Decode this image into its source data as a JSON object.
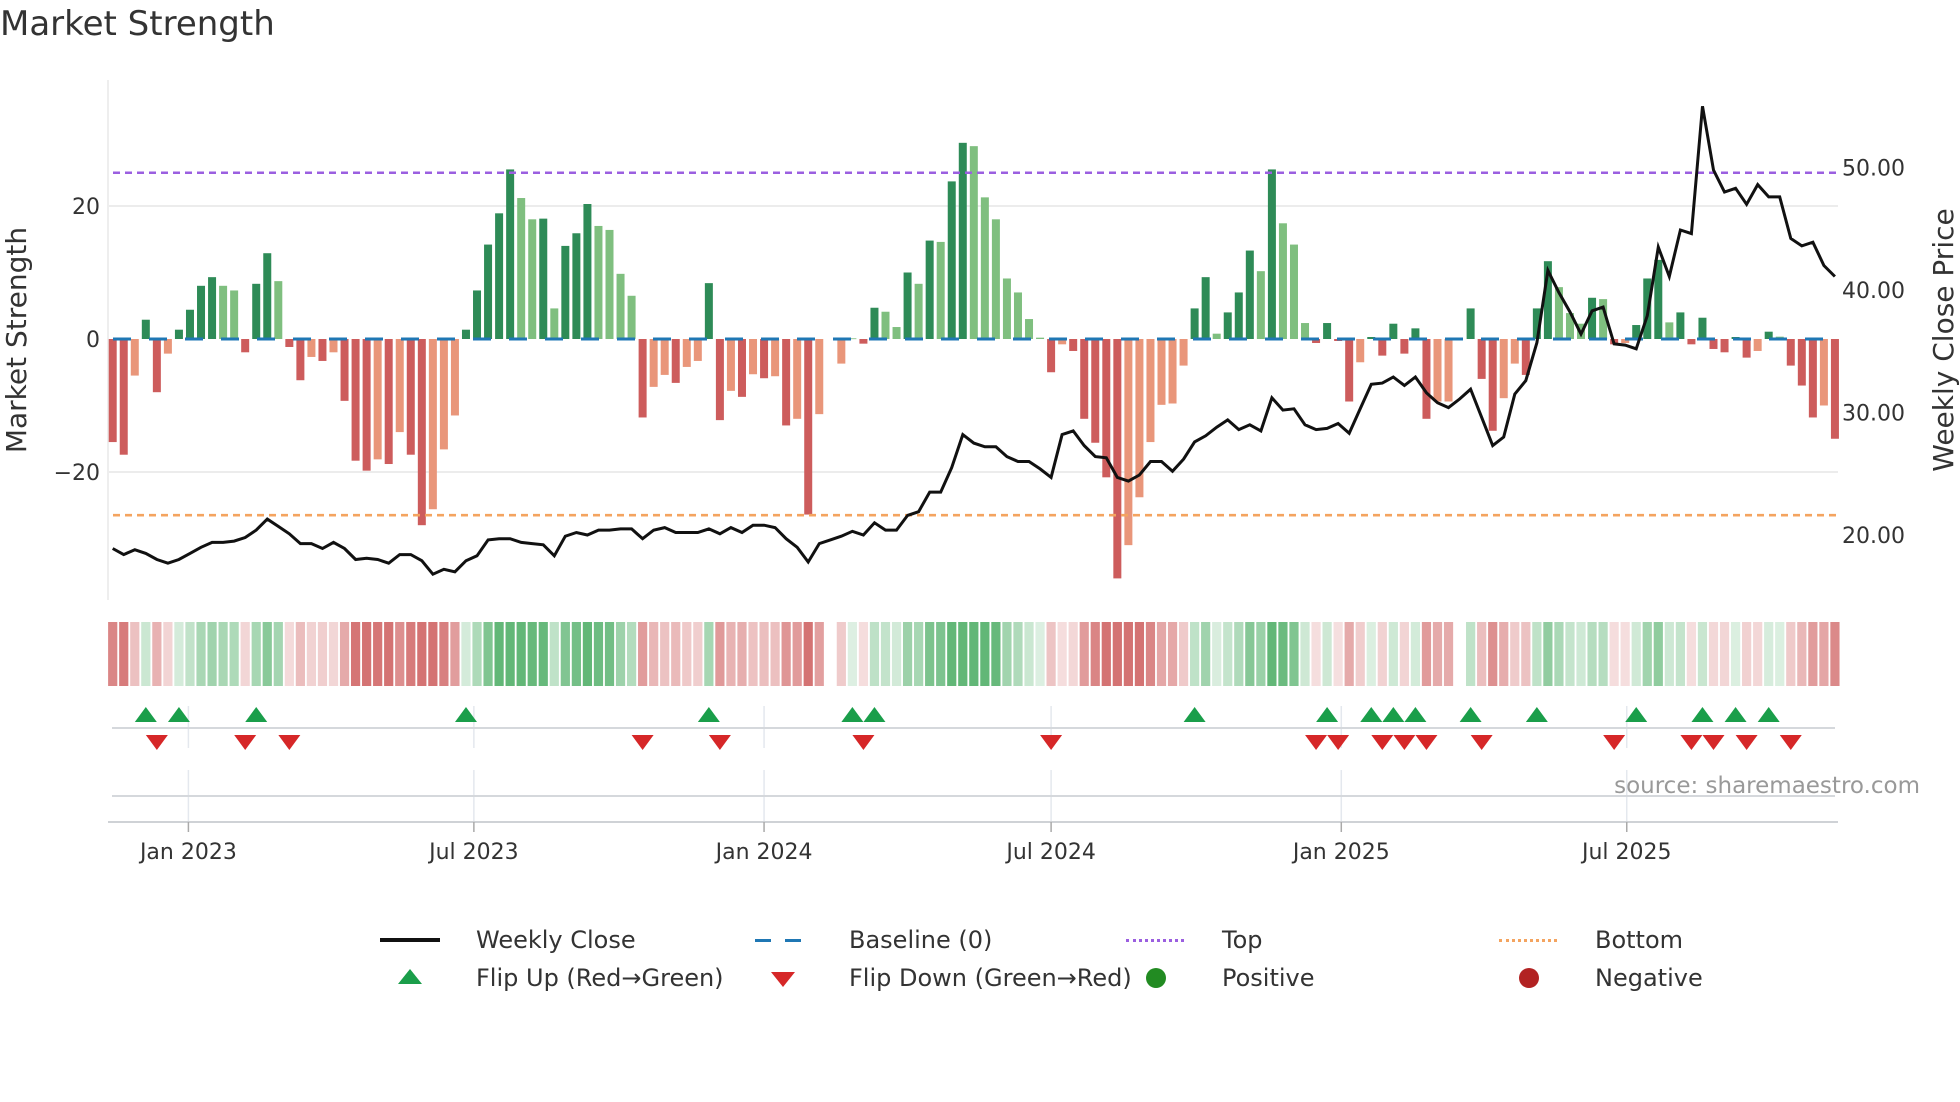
{
  "title": "Market Strength",
  "source": "source: sharemaestro.com",
  "legend": {
    "weekly_close": "Weekly Close",
    "baseline": "Baseline (0)",
    "top": "Top",
    "bottom": "Bottom",
    "flip_up": "Flip Up (Red→Green)",
    "flip_down": "Flip Down (Green→Red)",
    "positive": "Positive",
    "negative": "Negative"
  },
  "colors": {
    "dark_green": "#2e8b57",
    "light_green": "#7fbf7f",
    "dark_red": "#cd5c5c",
    "light_red": "#e9967a",
    "baseline": "#1f77b4",
    "top": "#9b5fe0",
    "bottom": "#f4a460",
    "close": "#111111",
    "flip_up": "#1a9e4a",
    "flip_down": "#d62728",
    "positive": "#228b22",
    "negative": "#b22222"
  },
  "chart_data": {
    "type": "bar",
    "title": "Market Strength",
    "ylabel": "Market Strength",
    "y2label": "Weekly Close Price",
    "start_date": "2022-11-14",
    "interval_days": 7,
    "ylim": [
      -38,
      35
    ],
    "y2lim": [
      14,
      58
    ],
    "y_ticks": [
      {
        "value": 20,
        "label": "20"
      },
      {
        "value": 0,
        "label": "0"
      },
      {
        "value": -20,
        "label": "−20"
      }
    ],
    "y2_ticks": [
      {
        "value": 50,
        "label": "50.00"
      },
      {
        "value": 40,
        "label": "40.00"
      },
      {
        "value": 30,
        "label": "30.00"
      },
      {
        "value": 20,
        "label": "20.00"
      }
    ],
    "x_ticks": [
      {
        "date": "2023-01-01",
        "label": "Jan 2023"
      },
      {
        "date": "2023-07-01",
        "label": "Jul 2023"
      },
      {
        "date": "2024-01-01",
        "label": "Jan 2024"
      },
      {
        "date": "2024-07-01",
        "label": "Jul 2024"
      },
      {
        "date": "2025-01-01",
        "label": "Jan 2025"
      },
      {
        "date": "2025-07-01",
        "label": "Jul 2025"
      }
    ],
    "top_level": 25,
    "bottom_level": -26.5,
    "baseline": 0,
    "strength": [
      -15.5,
      -17.4,
      -5.5,
      2.9,
      -8,
      -2.2,
      1.4,
      4.4,
      8,
      9.3,
      8,
      7.3,
      -2,
      8.3,
      12.9,
      8.7,
      -1.2,
      -6.2,
      -2.7,
      -3.3,
      -2,
      -9.3,
      -18.3,
      -19.8,
      -18.1,
      -18.8,
      -14,
      -17.4,
      -28,
      -25.6,
      -16.6,
      -11.5,
      1.4,
      7.3,
      14.2,
      18.9,
      25.5,
      21.2,
      18,
      18.1,
      4.6,
      14,
      15.9,
      20.3,
      17,
      16.4,
      9.8,
      6.5,
      -11.8,
      -7.2,
      -5.4,
      -6.6,
      -4.2,
      -3.3,
      8.4,
      -12.2,
      -7.8,
      -8.7,
      -5.3,
      -5.9,
      -5.6,
      -13,
      -12,
      -26.4,
      -11.3,
      0,
      -3.7,
      0.1,
      -0.7,
      4.7,
      4.1,
      1.8,
      10,
      8.3,
      14.8,
      14.6,
      23.7,
      29.5,
      29,
      21.3,
      18,
      9.1,
      7,
      3,
      0.2,
      -5,
      -0.8,
      -1.8,
      -12,
      -15.6,
      -20.8,
      -36,
      -31,
      -23.8,
      -15.5,
      -9.9,
      -9.7,
      -4,
      4.6,
      9.3,
      0.8,
      4,
      7,
      13.3,
      10.2,
      25.5,
      17.4,
      14.2,
      2.4,
      -0.6,
      2.4,
      -0.3,
      -9.4,
      -3.5,
      0.3,
      -2.5,
      2.3,
      -2.2,
      1.6,
      -12,
      -9.4,
      -9.4,
      0,
      4.6,
      -6,
      -13.8,
      -8.9,
      -3.7,
      -5.4,
      4.6,
      11.7,
      7.8,
      3.9,
      2.3,
      6.2,
      6,
      -0.8,
      -0.6,
      2.1,
      9.1,
      11.9,
      2.5,
      4,
      -0.8,
      3.2,
      -1.5,
      -2,
      0.3,
      -2.8,
      -1.8,
      1.1,
      0.35,
      -4,
      -7,
      -11.8,
      -10,
      -15
    ],
    "shade": [
      "dr",
      "dr",
      "lr",
      "dg",
      "dr",
      "lr",
      "dg",
      "dg",
      "dg",
      "dg",
      "lg",
      "lg",
      "dr",
      "dg",
      "dg",
      "lg",
      "dr",
      "dr",
      "lr",
      "dr",
      "lr",
      "dr",
      "dr",
      "dr",
      "lr",
      "dr",
      "lr",
      "dr",
      "dr",
      "lr",
      "lr",
      "lr",
      "dg",
      "dg",
      "dg",
      "dg",
      "dg",
      "lg",
      "lg",
      "dg",
      "lg",
      "dg",
      "dg",
      "dg",
      "lg",
      "lg",
      "lg",
      "lg",
      "dr",
      "lr",
      "lr",
      "dr",
      "lr",
      "lr",
      "dg",
      "dr",
      "lr",
      "dr",
      "lr",
      "dr",
      "lr",
      "dr",
      "lr",
      "dr",
      "lr",
      "lr",
      "lr",
      "lg",
      "dr",
      "dg",
      "lg",
      "lg",
      "dg",
      "lg",
      "dg",
      "lg",
      "dg",
      "dg",
      "lg",
      "lg",
      "lg",
      "lg",
      "lg",
      "lg",
      "lg",
      "dr",
      "lr",
      "dr",
      "dr",
      "dr",
      "dr",
      "dr",
      "lr",
      "lr",
      "lr",
      "lr",
      "lr",
      "lr",
      "dg",
      "dg",
      "lg",
      "dg",
      "dg",
      "dg",
      "lg",
      "dg",
      "lg",
      "lg",
      "lg",
      "dr",
      "dg",
      "dr",
      "dr",
      "lr",
      "dg",
      "dr",
      "dg",
      "dr",
      "dg",
      "dr",
      "lr",
      "lr",
      "lr",
      "dg",
      "dr",
      "dr",
      "lr",
      "lr",
      "dr",
      "dg",
      "dg",
      "lg",
      "lg",
      "lg",
      "dg",
      "lg",
      "dr",
      "lr",
      "dg",
      "dg",
      "dg",
      "lg",
      "dg",
      "dr",
      "dg",
      "dr",
      "dr",
      "dg",
      "dr",
      "lr",
      "dg",
      "lg",
      "dr",
      "dr",
      "dr",
      "lr",
      "dr"
    ],
    "weekly_close": [
      18.9,
      18.4,
      18.8,
      18.5,
      18.0,
      17.7,
      18.0,
      18.5,
      19.0,
      19.4,
      19.4,
      19.5,
      19.8,
      20.4,
      21.3,
      20.7,
      20.1,
      19.3,
      19.3,
      18.9,
      19.4,
      18.9,
      18.0,
      18.1,
      18.0,
      17.7,
      18.4,
      18.4,
      17.9,
      16.8,
      17.2,
      17.0,
      17.9,
      18.3,
      19.6,
      19.7,
      19.7,
      19.4,
      19.3,
      19.2,
      18.3,
      19.9,
      20.2,
      20.0,
      20.4,
      20.4,
      20.5,
      20.5,
      19.7,
      20.4,
      20.6,
      20.2,
      20.2,
      20.2,
      20.5,
      20.1,
      20.6,
      20.2,
      20.8,
      20.8,
      20.6,
      19.7,
      19.0,
      17.8,
      19.3,
      19.6,
      19.9,
      20.3,
      20.0,
      21.0,
      20.4,
      20.4,
      21.6,
      21.9,
      23.5,
      23.5,
      25.5,
      28.2,
      27.5,
      27.2,
      27.2,
      26.4,
      26.0,
      26.0,
      25.4,
      24.7,
      28.2,
      28.5,
      27.3,
      26.4,
      26.3,
      24.7,
      24.4,
      24.9,
      26.0,
      26.0,
      25.2,
      26.2,
      27.6,
      28.1,
      28.8,
      29.4,
      28.6,
      29.0,
      28.5,
      31.2,
      30.2,
      30.3,
      29.0,
      28.6,
      28.7,
      29.1,
      28.3,
      30.3,
      32.3,
      32.4,
      32.9,
      32.2,
      32.9,
      31.6,
      30.8,
      30.4,
      31.1,
      31.9,
      29.6,
      27.3,
      28.0,
      31.5,
      32.6,
      35.7,
      41.6,
      39.8,
      38.2,
      36.4,
      38.3,
      38.6,
      35.6,
      35.5,
      35.2,
      37.9,
      43.5,
      41.1,
      44.9,
      44.6,
      55.0,
      49.8,
      48.0,
      48.3,
      47.0,
      48.6,
      47.6,
      47.6,
      44.2,
      43.6,
      43.9,
      42.0,
      41.1
    ],
    "flip_up_weeks": [
      4,
      7,
      14,
      33,
      55,
      68,
      70,
      99,
      111,
      115,
      117,
      119,
      124,
      130,
      139,
      145,
      148,
      151
    ],
    "flip_down_weeks": [
      5,
      13,
      17,
      49,
      56,
      69,
      86,
      110,
      112,
      116,
      118,
      120,
      125,
      137,
      144,
      146,
      149,
      153
    ]
  }
}
